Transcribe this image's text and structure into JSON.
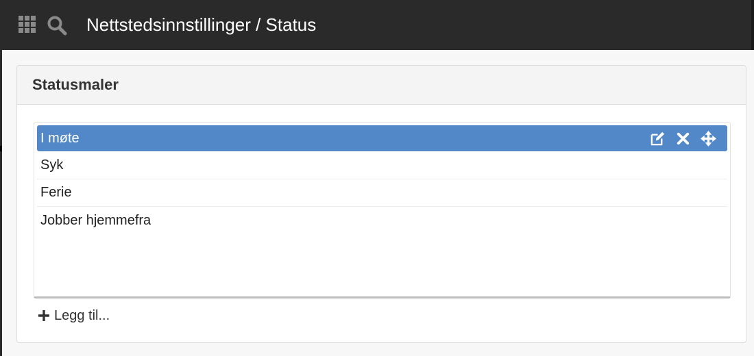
{
  "header": {
    "title": "Nettstedsinnstillinger / Status",
    "background": "#2a2a2a",
    "apps_icon": "grid-icon",
    "search_icon": "search-icon"
  },
  "panel": {
    "title": "Statusmaler",
    "items": [
      {
        "label": "I møte",
        "selected": true
      },
      {
        "label": "Syk",
        "selected": false
      },
      {
        "label": "Ferie",
        "selected": false
      },
      {
        "label": "Jobber hjemmefra",
        "selected": false
      }
    ],
    "item_actions": [
      "edit-icon",
      "close-icon",
      "move-icon"
    ],
    "add_label": "Legg til...",
    "selected_color": "#5388c8"
  }
}
